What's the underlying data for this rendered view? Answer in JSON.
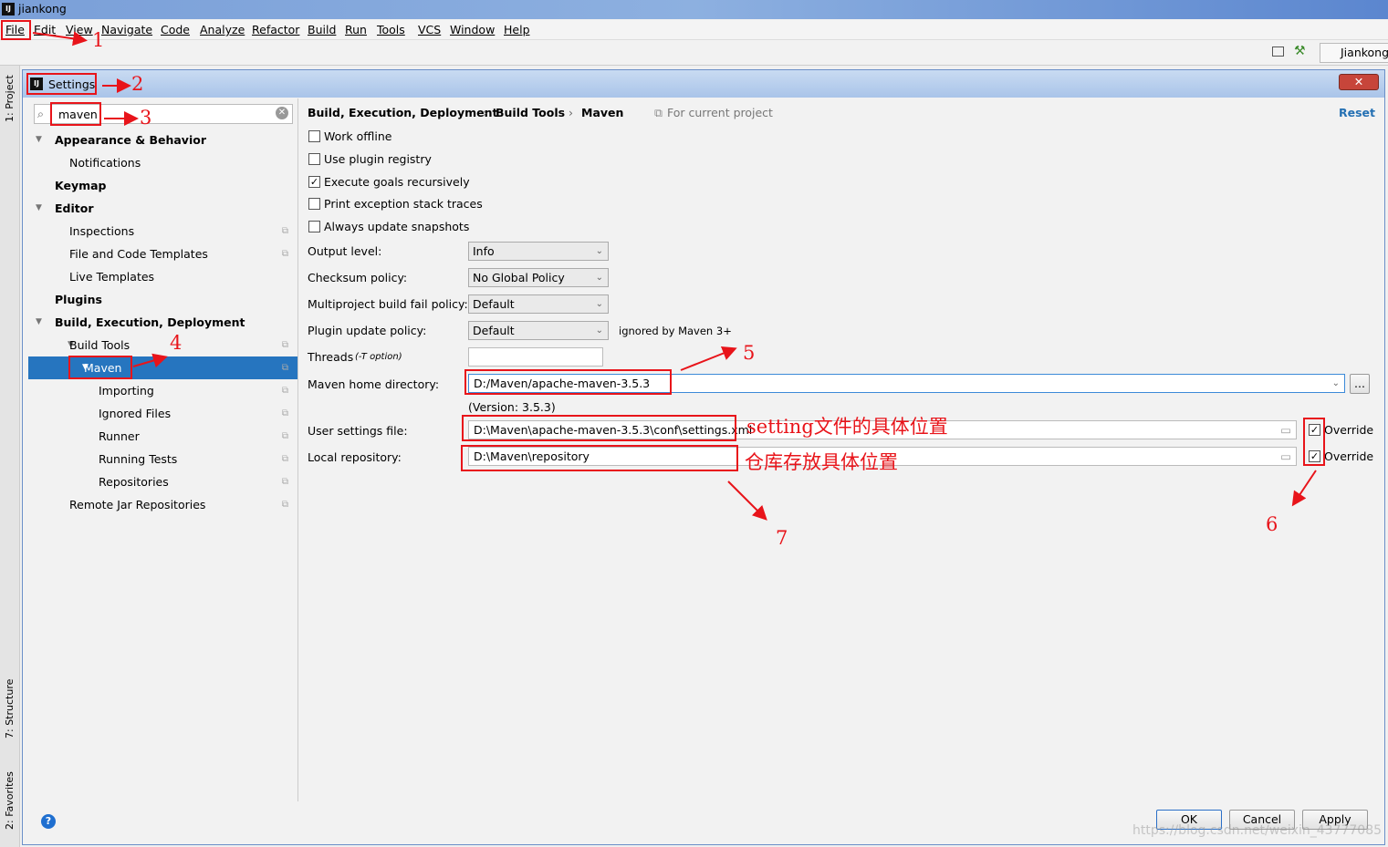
{
  "window": {
    "title": "jiankong",
    "project_button": "Jiankong"
  },
  "menu": [
    "File",
    "Edit",
    "View",
    "Navigate",
    "Code",
    "Analyze",
    "Refactor",
    "Build",
    "Run",
    "Tools",
    "VCS",
    "Window",
    "Help"
  ],
  "side_tools": {
    "project": "1: Project",
    "structure": "7: Structure",
    "favorites": "2: Favorites"
  },
  "dialog": {
    "title": "Settings",
    "close": "✕"
  },
  "search": {
    "value": "maven"
  },
  "tree": [
    {
      "label": "Appearance & Behavior",
      "bold": true,
      "expanded": true
    },
    {
      "label": "Notifications"
    },
    {
      "label": "Keymap",
      "bold": true
    },
    {
      "label": "Editor",
      "bold": true,
      "expanded": true
    },
    {
      "label": "Inspections"
    },
    {
      "label": "File and Code Templates"
    },
    {
      "label": "Live Templates"
    },
    {
      "label": "Plugins",
      "bold": true
    },
    {
      "label": "Build, Execution, Deployment",
      "bold": true,
      "expanded": true
    },
    {
      "label": "Build Tools",
      "expanded": true
    },
    {
      "label": "Maven",
      "selected": true,
      "expanded": true
    },
    {
      "label": "Importing"
    },
    {
      "label": "Ignored Files"
    },
    {
      "label": "Runner"
    },
    {
      "label": "Running Tests"
    },
    {
      "label": "Repositories"
    },
    {
      "label": "Remote Jar Repositories"
    }
  ],
  "breadcrumb": [
    "Build, Execution, Deployment",
    "Build Tools",
    "Maven"
  ],
  "for_current_project": "For current project",
  "reset": "Reset",
  "checkboxes": [
    {
      "label": "Work offline",
      "checked": false
    },
    {
      "label": "Use plugin registry",
      "checked": false
    },
    {
      "label": "Execute goals recursively",
      "checked": true
    },
    {
      "label": "Print exception stack traces",
      "checked": false
    },
    {
      "label": "Always update snapshots",
      "checked": false
    }
  ],
  "fields": {
    "output_level": {
      "label": "Output level:",
      "value": "Info"
    },
    "checksum": {
      "label": "Checksum policy:",
      "value": "No Global Policy"
    },
    "multiproject": {
      "label": "Multiproject build fail policy:",
      "value": "Default"
    },
    "plugin_update": {
      "label": "Plugin update policy:",
      "value": "Default",
      "note": "ignored by Maven 3+"
    },
    "threads": {
      "label": "Threads",
      "hint": "(-T option)",
      "value": ""
    },
    "maven_home": {
      "label": "Maven home directory:",
      "value": "D:/Maven/apache-maven-3.5.3",
      "version": "(Version: 3.5.3)",
      "browse": "..."
    },
    "user_settings": {
      "label": "User settings file:",
      "value": "D:\\Maven\\apache-maven-3.5.3\\conf\\settings.xml",
      "override": "Override",
      "override_checked": true
    },
    "local_repo": {
      "label": "Local repository:",
      "value": "D:\\Maven\\repository",
      "override": "Override",
      "override_checked": true
    }
  },
  "buttons": {
    "ok": "OK",
    "cancel": "Cancel",
    "apply": "Apply",
    "help": "?"
  },
  "annotations": {
    "n1": "1",
    "n2": "2",
    "n3": "3",
    "n4": "4",
    "n5": "5",
    "n6": "6",
    "n7": "7",
    "settings_note": "setting文件的具体位置",
    "repo_note": "仓库存放具体位置"
  },
  "watermark": "https://blog.csdn.net/weixin_43777085",
  "colors": {
    "selection": "#2675bf",
    "annotation": "#e8141a",
    "link": "#2470b3"
  }
}
